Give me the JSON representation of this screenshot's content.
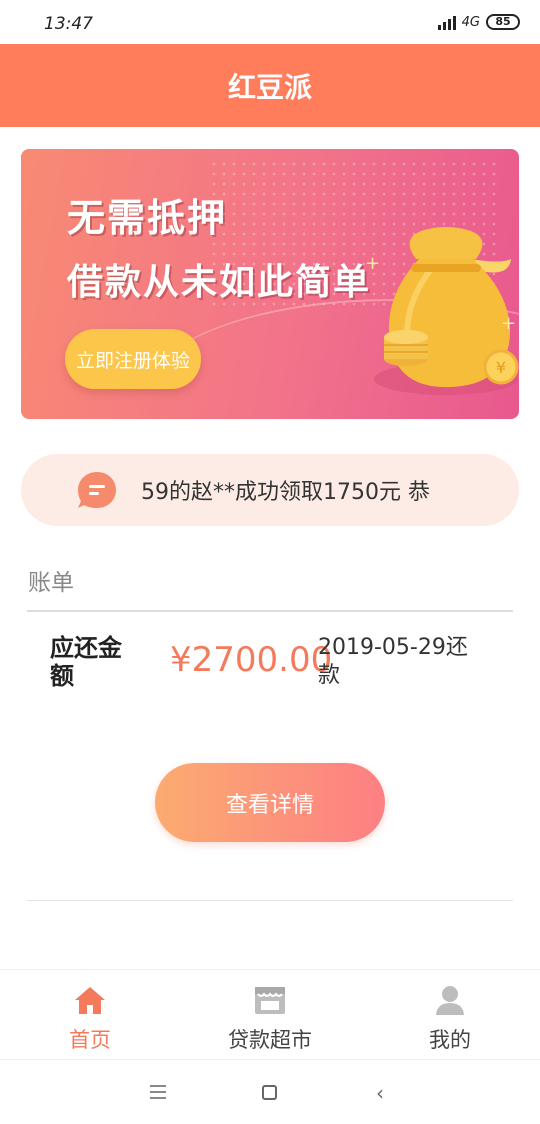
{
  "status_bar": {
    "time": "13:47",
    "network": "4G",
    "battery": "85"
  },
  "header": {
    "title": "红豆派"
  },
  "banner": {
    "line1": "无需抵押",
    "line2": "借款从未如此简单",
    "cta": "立即注册体验",
    "coin_symbol": "¥"
  },
  "notice": {
    "text": "59的赵**成功领取1750元 恭"
  },
  "bill": {
    "section_title": "账单",
    "label": "应还金额",
    "amount": "¥2700.00",
    "due": "2019-05-29还款"
  },
  "detail_button": {
    "label": "查看详情"
  },
  "tabs": [
    {
      "label": "首页",
      "icon": "home-icon",
      "active": true
    },
    {
      "label": "贷款超市",
      "icon": "store-icon",
      "active": false
    },
    {
      "label": "我的",
      "icon": "user-icon",
      "active": false
    }
  ],
  "colors": {
    "accent": "#ff7d5a",
    "amount": "#f47a5c",
    "notice_bg": "#fdece6"
  }
}
